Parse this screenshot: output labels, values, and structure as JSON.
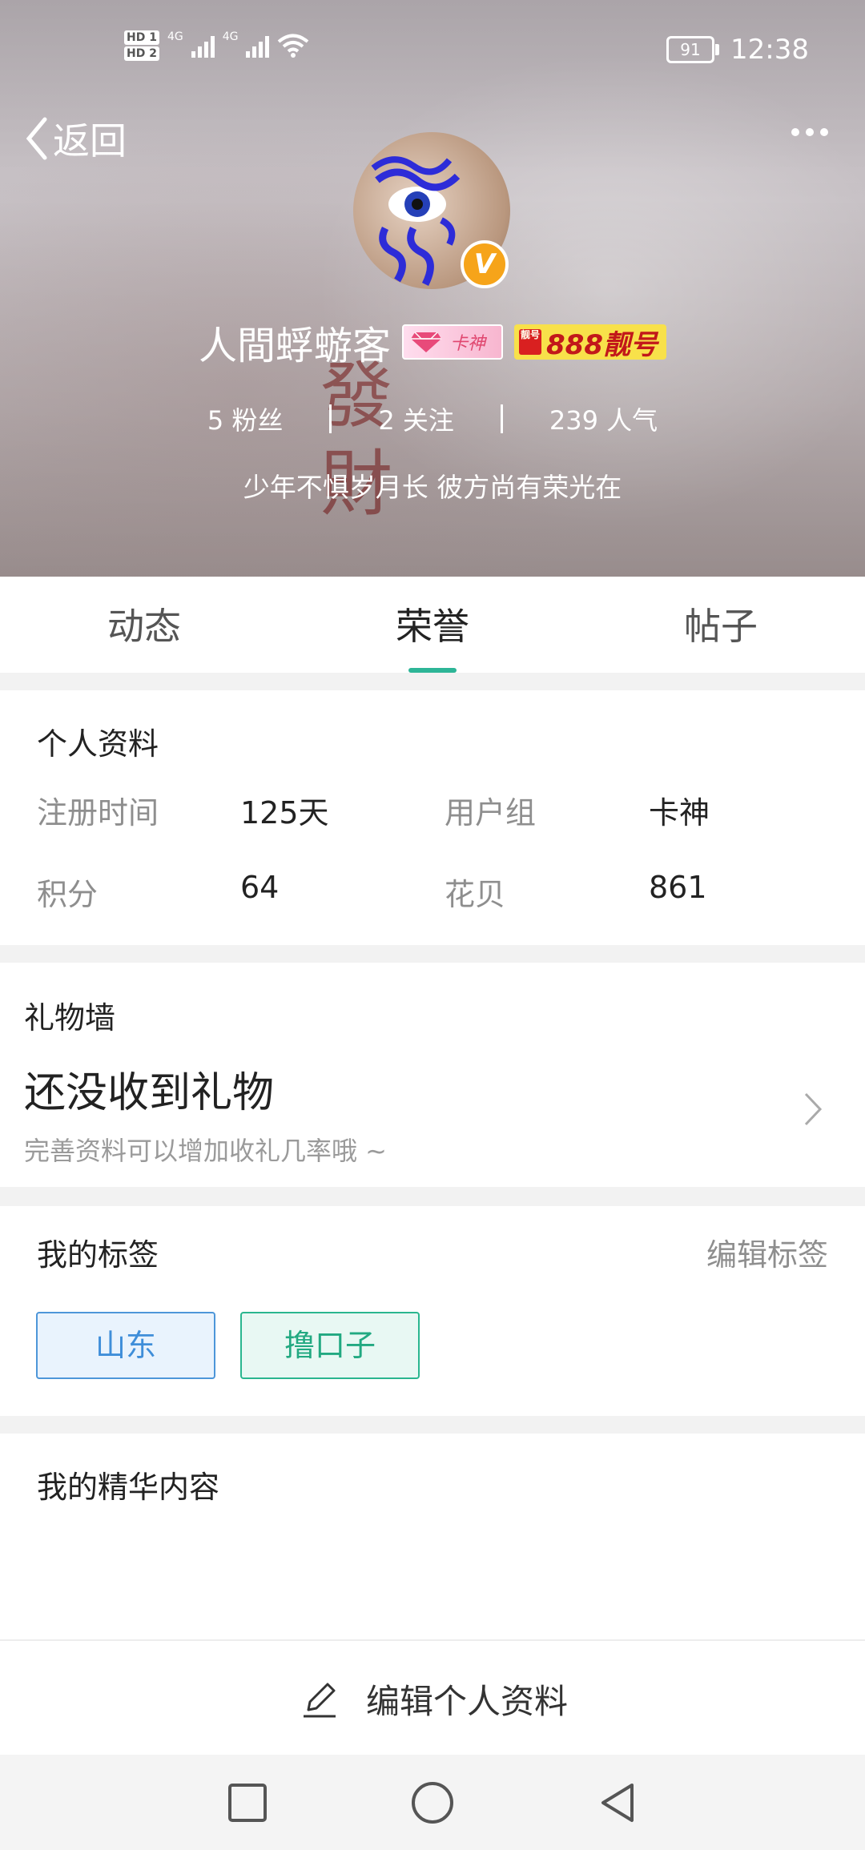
{
  "status": {
    "hd1": "HD 1",
    "hd2": "HD 2",
    "net1": "4G",
    "net2": "4G",
    "battery": "91",
    "time": "12:38"
  },
  "header": {
    "back_label": "返回"
  },
  "profile": {
    "name": "人間蜉蝣客",
    "badge_k": "卡神",
    "badge_888_seal": "靓号",
    "badge_888": "888靓号",
    "verify_mark": "V",
    "fans": "5 粉丝",
    "following": "2 关注",
    "popularity": "239 人气",
    "motto": "少年不惧岁月长 彼方尚有荣光在"
  },
  "tabs": [
    {
      "label": "动态"
    },
    {
      "label": "荣誉"
    },
    {
      "label": "帖子"
    }
  ],
  "personal": {
    "title": "个人资料",
    "fields": [
      {
        "label": "注册时间",
        "value": "125天"
      },
      {
        "label": "用户组",
        "value": "卡神"
      },
      {
        "label": "积分",
        "value": "64"
      },
      {
        "label": "花贝",
        "value": "861"
      }
    ]
  },
  "gifts": {
    "title": "礼物墙",
    "empty": "还没收到礼物",
    "hint": "完善资料可以增加收礼几率哦 ~"
  },
  "tags_section": {
    "title": "我的标签",
    "edit": "编辑标签",
    "tags": [
      "山东",
      "撸口子"
    ]
  },
  "featured": {
    "title": "我的精华内容"
  },
  "actions": {
    "edit_profile": "编辑个人资料"
  },
  "colors": {
    "accent": "#2db597",
    "tag_blue": "#3f8ed9",
    "tag_green": "#22a981",
    "verify": "#f6a41a"
  }
}
